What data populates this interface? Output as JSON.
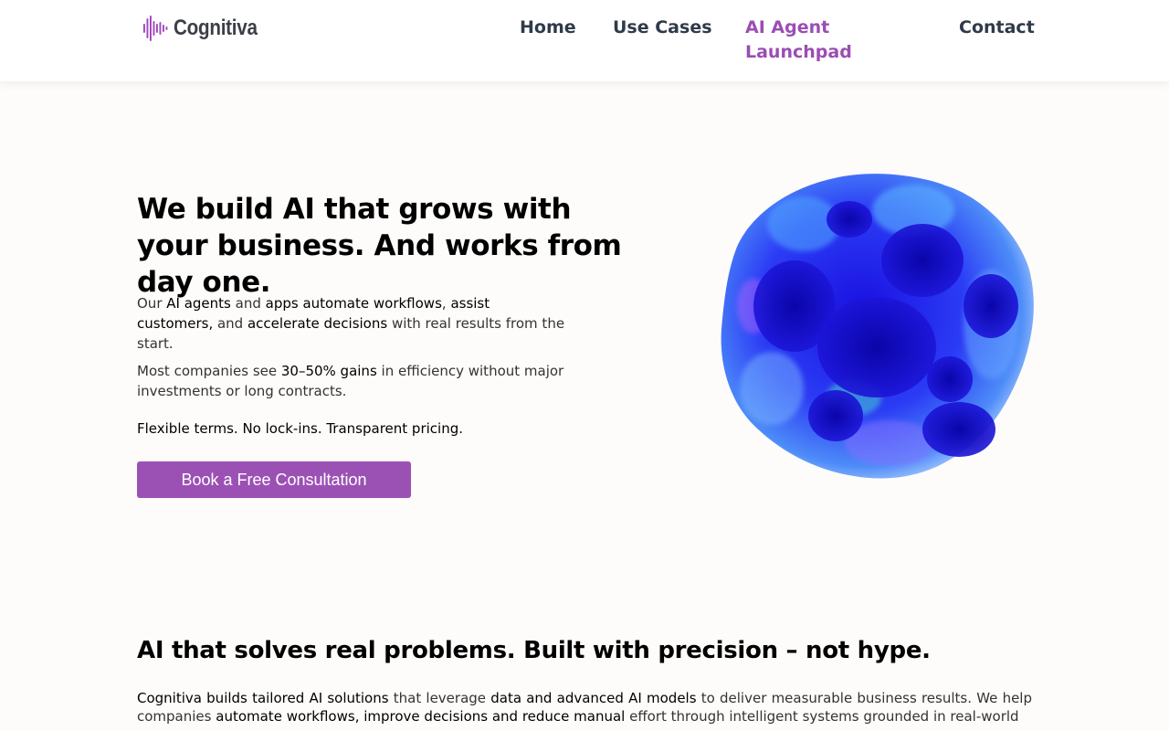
{
  "brand": {
    "name": "Cognitiva",
    "accent": "#9b51b4"
  },
  "nav": {
    "items": [
      {
        "label": "Home"
      },
      {
        "label": "Use Cases"
      },
      {
        "label": "AI Agent Launchpad",
        "active": true
      },
      {
        "label": "Contact"
      }
    ]
  },
  "hero": {
    "title": "We build AI that grows with your business. And works from day one.",
    "p1": {
      "t1": "Our ",
      "b1": "AI agents",
      "t2": " and ",
      "b2": "apps automate workflows",
      "t3": ", ",
      "b3": "assist customers,",
      "t4": " and ",
      "b4": "accelerate decisions",
      "t5": " with real results from the start."
    },
    "p2": {
      "t1": "Most companies see ",
      "b1": "30–50% gains",
      "t2": " in efficiency without major investments or long contracts."
    },
    "p3": "Flexible terms. No lock-ins. Transparent pricing.",
    "cta_label": "Book a Free Consultation",
    "image_icon": "abstract-blue-blob-image"
  },
  "section": {
    "title": "AI that solves real problems. Built with precision – not hype.",
    "body": {
      "b1": "Cognitiva builds tailored AI solutions",
      "t1": " that leverage ",
      "b2": "data and advanced AI models",
      "t2": " to deliver measurable business results. We help companies ",
      "b3": "automate workflows, improve decisions and reduce manual",
      "t3": " effort through intelligent systems grounded in real-world"
    }
  }
}
